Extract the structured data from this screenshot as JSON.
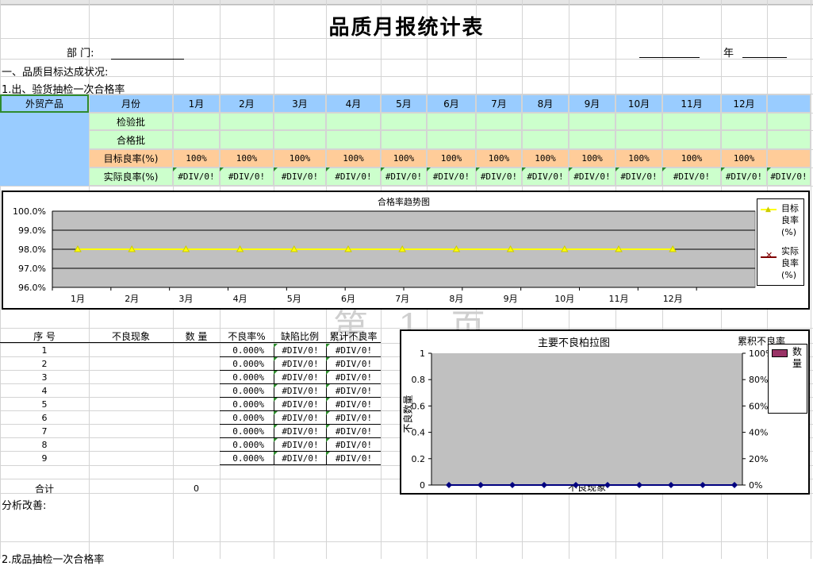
{
  "title": "品质月报统计表",
  "header": {
    "dept_label": "部  门:",
    "year_label": "年",
    "section1": "一、品质目标达成状况:",
    "subsection1": "1.出、验货抽检一次合格率",
    "subsection2": "2.成品抽检一次合格率"
  },
  "quality_table": {
    "product_label": "外贸产品",
    "month_header": "月份",
    "months": [
      "1月",
      "2月",
      "3月",
      "4月",
      "5月",
      "6月",
      "7月",
      "8月",
      "9月",
      "10月",
      "11月",
      "12月"
    ],
    "row_labels": [
      "检验批",
      "合格批",
      "目标良率(%)",
      "实际良率(%)"
    ],
    "target_values": [
      "100%",
      "100%",
      "100%",
      "100%",
      "100%",
      "100%",
      "100%",
      "100%",
      "100%",
      "100%",
      "100%",
      "100%"
    ],
    "actual_values": [
      "#DIV/0!",
      "#DIV/0!",
      "#DIV/0!",
      "#DIV/0!",
      "#DIV/0!",
      "#DIV/0!",
      "#DIV/0!",
      "#DIV/0!",
      "#DIV/0!",
      "#DIV/0!",
      "#DIV/0!",
      "#DIV/0!",
      "#DIV/0!"
    ]
  },
  "defect_table": {
    "headers": [
      "序  号",
      "不良现象",
      "数  量",
      "不良率%",
      "缺陷比例",
      "累计不良率"
    ],
    "rows": [
      {
        "no": "1",
        "rate": "0.000%",
        "ratio": "#DIV/0!",
        "cum": "#DIV/0!"
      },
      {
        "no": "2",
        "rate": "0.000%",
        "ratio": "#DIV/0!",
        "cum": "#DIV/0!"
      },
      {
        "no": "3",
        "rate": "0.000%",
        "ratio": "#DIV/0!",
        "cum": "#DIV/0!"
      },
      {
        "no": "4",
        "rate": "0.000%",
        "ratio": "#DIV/0!",
        "cum": "#DIV/0!"
      },
      {
        "no": "5",
        "rate": "0.000%",
        "ratio": "#DIV/0!",
        "cum": "#DIV/0!"
      },
      {
        "no": "6",
        "rate": "0.000%",
        "ratio": "#DIV/0!",
        "cum": "#DIV/0!"
      },
      {
        "no": "7",
        "rate": "0.000%",
        "ratio": "#DIV/0!",
        "cum": "#DIV/0!"
      },
      {
        "no": "8",
        "rate": "0.000%",
        "ratio": "#DIV/0!",
        "cum": "#DIV/0!"
      },
      {
        "no": "9",
        "rate": "0.000%",
        "ratio": "#DIV/0!",
        "cum": "#DIV/0!"
      }
    ],
    "total_label": "合计",
    "total_qty": "0",
    "analysis_label": "分析改善:"
  },
  "watermark": "第 1 页",
  "colors": {
    "header_blue": "#99ccff",
    "row_green": "#ccffcc",
    "row_orange": "#ffcc99",
    "plot_gray": "#c0c0c0",
    "target_line": "#ffff00",
    "actual_line": "#800000",
    "bar_color": "#993366",
    "selection_green": "#2e8b2e"
  },
  "chart_data": [
    {
      "type": "line",
      "title": "合格率趋势图",
      "categories": [
        "1月",
        "2月",
        "3月",
        "4月",
        "5月",
        "6月",
        "7月",
        "8月",
        "9月",
        "10月",
        "11月",
        "12月"
      ],
      "series": [
        {
          "name": "目标良率(%)",
          "values": [
            98,
            98,
            98,
            98,
            98,
            98,
            98,
            98,
            98,
            98,
            98,
            98
          ]
        },
        {
          "name": "实际良率(%)",
          "values": []
        }
      ],
      "y_ticks": [
        "100.0%",
        "99.0%",
        "98.0%",
        "97.0%",
        "96.0%"
      ],
      "ylim": [
        96,
        100
      ],
      "legend": "right",
      "grid": true
    },
    {
      "type": "bar",
      "title": "主要不良柏拉图",
      "xlabel": "不良现象",
      "ylabel": "不良数量",
      "right_axis_label": "累积不良率",
      "series": [
        {
          "name": "数量",
          "values": [
            0,
            0,
            0,
            0,
            0,
            0,
            0,
            0,
            0
          ]
        }
      ],
      "y_ticks": [
        "1",
        "0.8",
        "0.6",
        "0.4",
        "0.2",
        "0"
      ],
      "y2_ticks": [
        "100%",
        "80%",
        "60%",
        "40%",
        "20%",
        "0%"
      ],
      "ylim": [
        0,
        1
      ],
      "legend": "top-right"
    }
  ]
}
